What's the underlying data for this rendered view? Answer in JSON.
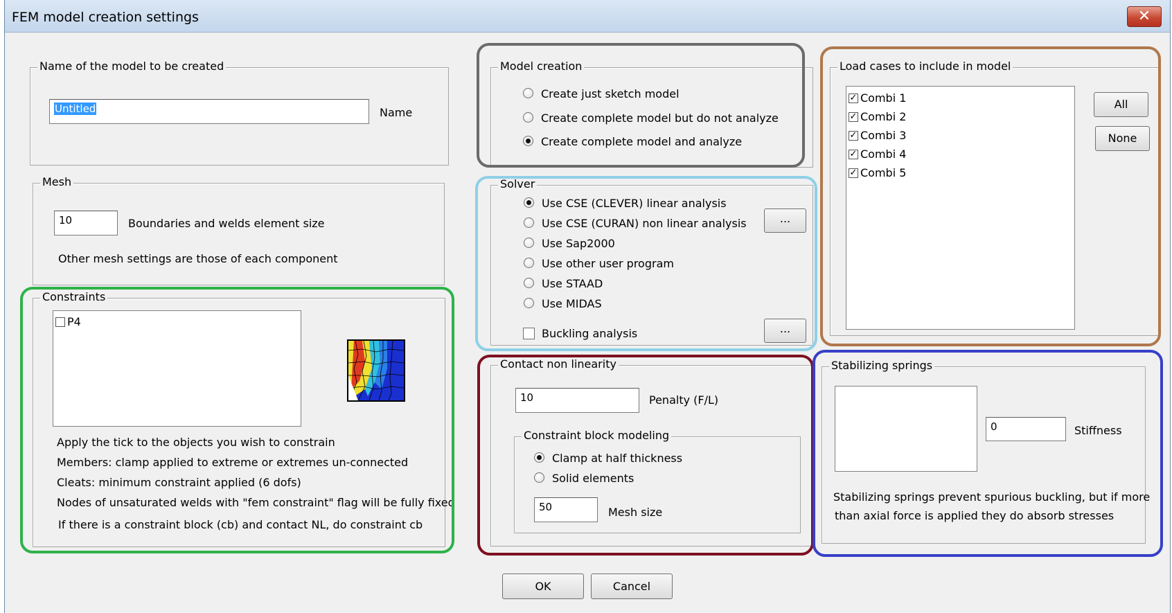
{
  "window": {
    "title": "FEM model creation settings",
    "close_label": "✕"
  },
  "name_group": {
    "legend": "Name of the model to be created",
    "name_value": "Untitled",
    "name_label": "Name"
  },
  "mesh_group": {
    "legend": "Mesh",
    "size_value": "10",
    "size_label": "Boundaries and welds element size",
    "note": "Other mesh settings are those of each component"
  },
  "constraints_group": {
    "legend": "Constraints",
    "items": [
      {
        "label": "P4",
        "checked": false
      }
    ],
    "notes": [
      "Apply the tick to the objects you wish to constrain",
      "Members: clamp applied to extreme or extremes un-connected",
      "Cleats: minimum constraint applied (6 dofs)",
      "Nodes of unsaturated welds with \"fem constraint\" flag will be fully fixed",
      "If there is a constraint block (cb) and contact NL, do constraint cb"
    ]
  },
  "model_creation": {
    "legend": "Model creation",
    "options": [
      {
        "label": "Create just sketch model",
        "selected": false
      },
      {
        "label": "Create complete model but do not analyze",
        "selected": false
      },
      {
        "label": "Create complete model and analyze",
        "selected": true
      }
    ]
  },
  "solver": {
    "legend": "Solver",
    "options": [
      {
        "label": "Use CSE (CLEVER) linear analysis",
        "selected": true
      },
      {
        "label": "Use CSE (CURAN) non linear analysis",
        "selected": false
      },
      {
        "label": "Use Sap2000",
        "selected": false
      },
      {
        "label": "Use other user program",
        "selected": false
      },
      {
        "label": "Use STAAD",
        "selected": false
      },
      {
        "label": "Use MIDAS",
        "selected": false
      }
    ],
    "buckling_label": "Buckling analysis",
    "buckling_checked": false,
    "ellipsis_label": "..."
  },
  "contact": {
    "legend": "Contact non linearity",
    "penalty_value": "10",
    "penalty_label": "Penalty (F/L)",
    "block_legend": "Constraint block modeling",
    "block_options": [
      {
        "label": "Clamp at half thickness",
        "selected": true
      },
      {
        "label": "Solid elements",
        "selected": false
      }
    ],
    "mesh_value": "50",
    "mesh_label": "Mesh size"
  },
  "load_cases": {
    "legend": "Load cases to include in model",
    "items": [
      {
        "label": "Combi 1",
        "checked": true
      },
      {
        "label": "Combi 2",
        "checked": true
      },
      {
        "label": "Combi 3",
        "checked": true
      },
      {
        "label": "Combi 4",
        "checked": true
      },
      {
        "label": "Combi 5",
        "checked": true
      }
    ],
    "all_label": "All",
    "none_label": "None"
  },
  "springs": {
    "legend": "Stabilizing springs",
    "stiffness_value": "0",
    "stiffness_label": "Stiffness",
    "note_line1": "Stabilizing springs prevent spurious buckling, but if more",
    "note_line2": "than axial force is applied they do absorb stresses"
  },
  "footer": {
    "ok_label": "OK",
    "cancel_label": "Cancel"
  },
  "highlight_colors": {
    "model_creation": "#6b6b6b",
    "load_cases": "#b0784c",
    "solver": "#8fd0e6",
    "constraints": "#2fb24a",
    "contact": "#7d1020",
    "springs": "#3740c8"
  },
  "icons": {
    "close": "close-icon",
    "constraint_preview": "fem-mesh-preview-icon",
    "check": "checkmark-icon"
  }
}
